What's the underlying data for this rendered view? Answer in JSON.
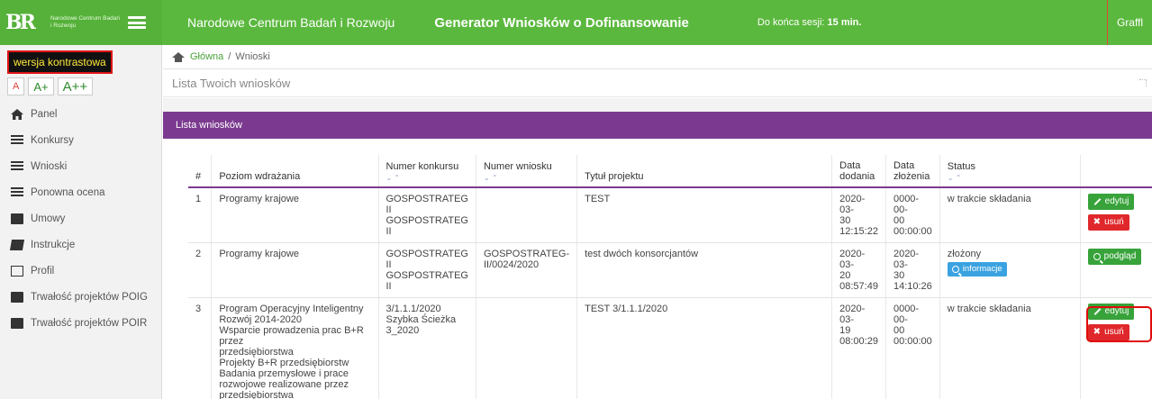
{
  "header": {
    "logo_mark": "BR",
    "logo_text": "Narodowe Centrum Badań i Rozwoju",
    "org_name": "Narodowe Centrum Badań i Rozwoju",
    "app_title": "Generator Wniosków o Dofinansowanie",
    "session_label": "Do końca sesji:",
    "session_value": "15 min.",
    "user": "Graffl",
    "color": "#5bb83e"
  },
  "accessibility": {
    "contrast_label": "wersja kontrastowa",
    "font_small": "A",
    "font_medium": "A+",
    "font_large": "A++"
  },
  "sidebar": {
    "items": [
      {
        "label": "Panel",
        "icon": "home-icon"
      },
      {
        "label": "Konkursy",
        "icon": "list-icon"
      },
      {
        "label": "Wnioski",
        "icon": "list-icon"
      },
      {
        "label": "Ponowna ocena",
        "icon": "list-icon"
      },
      {
        "label": "Umowy",
        "icon": "folder-icon"
      },
      {
        "label": "Instrukcje",
        "icon": "book-icon"
      },
      {
        "label": "Profil",
        "icon": "image-icon"
      },
      {
        "label": "Trwałość projektów POIG",
        "icon": "folder-icon"
      },
      {
        "label": "Trwałość projektów POIR",
        "icon": "folder-icon"
      }
    ]
  },
  "breadcrumb": {
    "home": "Główna",
    "separator": "/",
    "current": "Wnioski"
  },
  "page_title": "Lista Twoich wniosków",
  "panel": {
    "title": "Lista wniosków",
    "color": "#7b3a8f"
  },
  "table": {
    "headers": {
      "num": "#",
      "level": "Poziom wdrażania",
      "contest": "Numer konkursu",
      "application": "Numer wniosku",
      "title": "Tytuł projektu",
      "added": "Data dodania",
      "submitted": "Data złożenia",
      "status": "Status",
      "sort_glyph": "⌄ ⌃"
    },
    "rows": [
      {
        "num": "1",
        "level": "Programy krajowe",
        "contest": "GOSPOSTRATEG II\nGOSPOSTRATEG II",
        "application": "",
        "title": "TEST",
        "added": "2020-03-\n30\n12:15:22",
        "submitted": "0000-00-\n00\n00:00:00",
        "status": "w trakcie składania",
        "badge": "",
        "buttons": [
          "edytuj",
          "usuń"
        ]
      },
      {
        "num": "2",
        "level": "Programy krajowe",
        "contest": "GOSPOSTRATEG II\nGOSPOSTRATEG II",
        "application": "GOSPOSTRATEG-\nII/0024/2020",
        "title": "test dwóch konsorcjantów",
        "added": "2020-03-\n20\n08:57:49",
        "submitted": "2020-03-\n30\n14:10:26",
        "status": "złożony",
        "badge": "informacje",
        "buttons": [
          "podgląd"
        ]
      },
      {
        "num": "3",
        "level": "Program Operacyjny Inteligentny\nRozwój 2014-2020\nWsparcie prowadzenia prac B+R przez\nprzedsiębiorstwa\nProjekty B+R przedsiębiorstw\nBadania przemysłowe i prace\nrozwojowe realizowane przez\nprzedsiębiorstwa",
        "contest": "3/1.1.1/2020\nSzybka Ścieżka\n3_2020",
        "application": "",
        "title": "TEST 3/1.1.1/2020",
        "added": "2020-03-\n19\n08:00:29",
        "submitted": "0000-00-\n00\n00:00:00",
        "status": "w trakcie składania",
        "badge": "",
        "buttons": [
          "edytuj",
          "usuń"
        ]
      }
    ]
  }
}
